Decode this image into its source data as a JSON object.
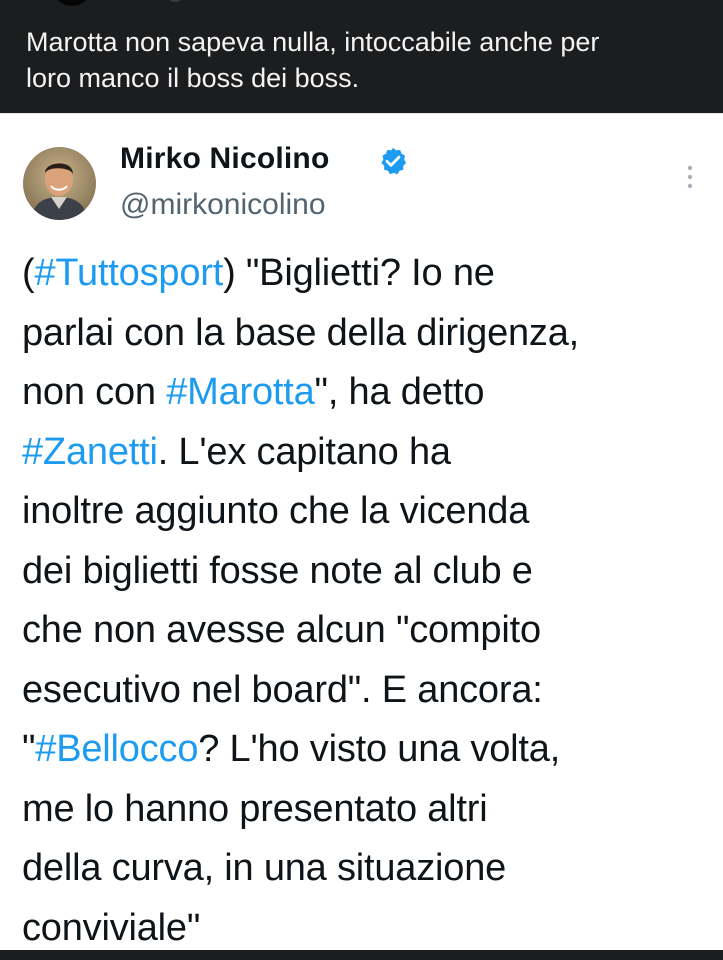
{
  "post": {
    "caption": "Marotta non sapeva nulla, intoccabile anche per\nloro manco il boss dei boss."
  },
  "tweet": {
    "author_name": "Mirko Nicolino",
    "handle": "@mirkonicolino",
    "verified_icon": "verified-badge-icon",
    "more_icon": "more-vertical-icon",
    "accent_color": "#1d9bf0",
    "text": {
      "l1_p1": "(",
      "l1_tag": "#Tuttosport",
      "l1_p2": ") \"Biglietti? Io ne",
      "l2": "parlai con la base della dirigenza,",
      "l3_p1": "non con ",
      "l3_tag": "#Marotta",
      "l3_p2": "\", ha detto",
      "l4_tag": "#Zanetti",
      "l4_p2": ". L'ex capitano ha",
      "l5": "inoltre aggiunto che la vicenda",
      "l6": "dei biglietti fosse note al club e",
      "l7": "che non avesse alcun \"compito",
      "l8": "esecutivo nel board\". E ancora:",
      "l9_p1": "\"",
      "l9_tag": "#Bellocco",
      "l9_p2": "? L'ho visto una volta,",
      "l10": "me lo hanno presentato altri",
      "l11": "della curva, in una situazione",
      "l12": "conviviale\""
    }
  }
}
